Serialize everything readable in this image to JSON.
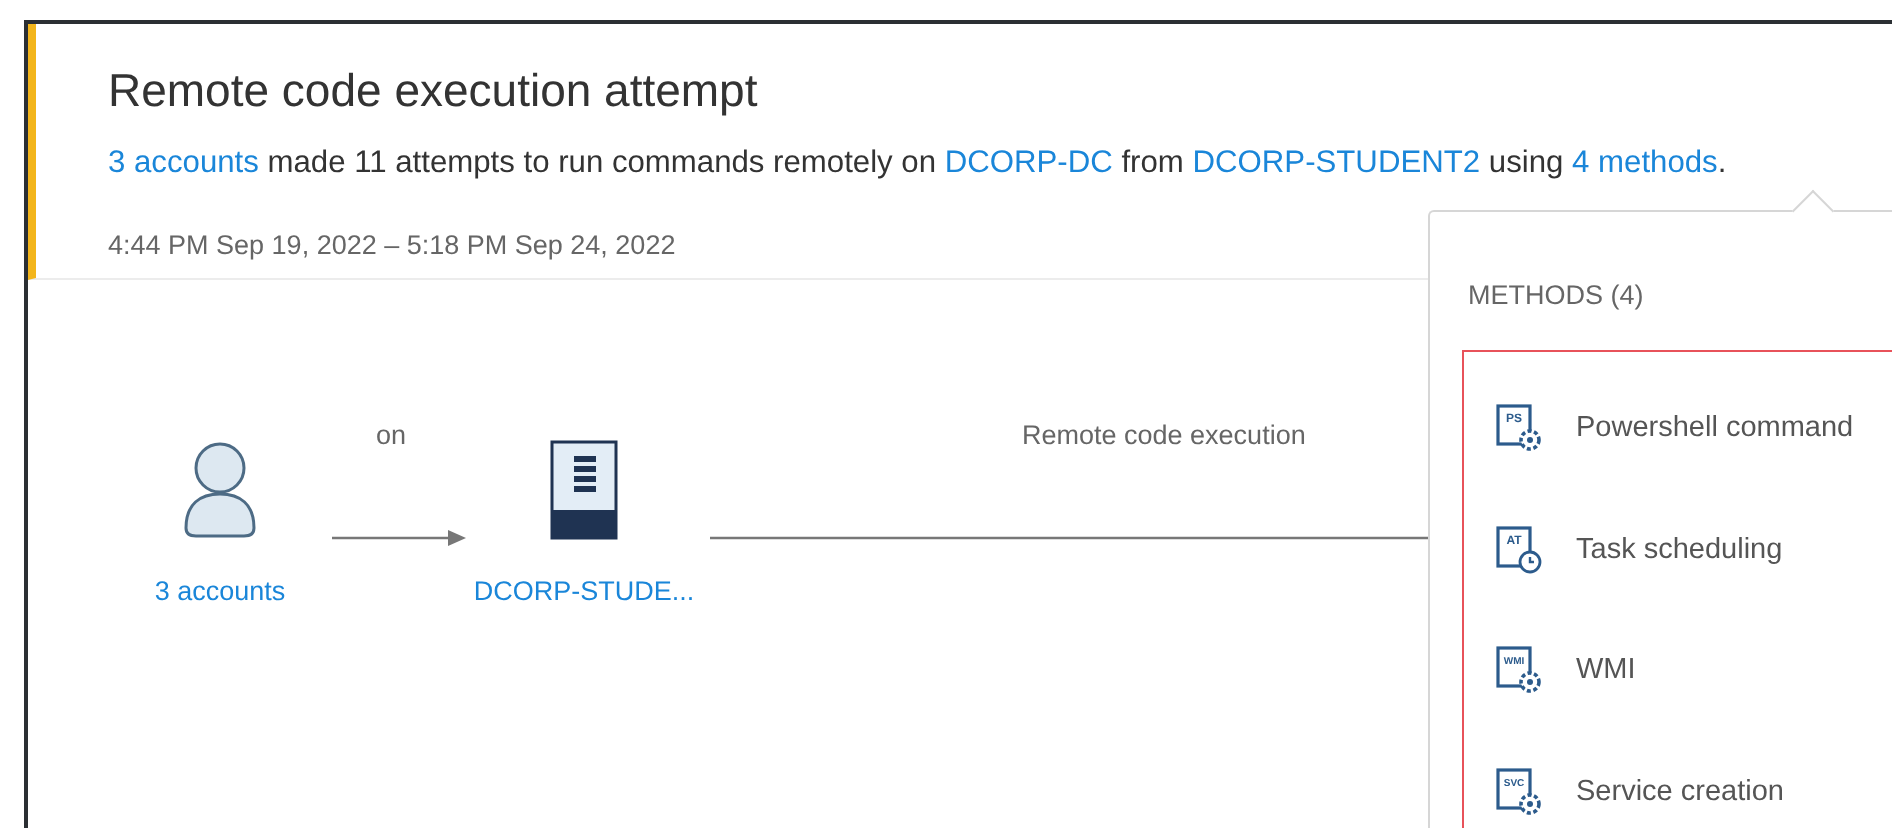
{
  "alert": {
    "title": "Remote code execution attempt",
    "summary": [
      {
        "text": "3 accounts",
        "kind": "link"
      },
      {
        "text": " made 11 attempts to run commands remotely on ",
        "kind": "plain"
      },
      {
        "text": "DCORP-DC",
        "kind": "link"
      },
      {
        "text": " from ",
        "kind": "plain"
      },
      {
        "text": "DCORP-STUDENT2",
        "kind": "link"
      },
      {
        "text": " using ",
        "kind": "plain"
      },
      {
        "text": "4 methods",
        "kind": "link"
      },
      {
        "text": ".",
        "kind": "plain"
      }
    ],
    "time_range": "4:44 PM Sep 19, 2022 – 5:18 PM Sep 24, 2022"
  },
  "diagram": {
    "source": {
      "kind": "user",
      "label": "3 accounts"
    },
    "relation": "on",
    "target": {
      "kind": "server",
      "label": "DCORP-STUDE..."
    },
    "activity": "Remote code execution"
  },
  "methods_popover": {
    "heading": "METHODS (4)",
    "highlighted": true,
    "items": [
      {
        "badge": "PS",
        "kind": "gear",
        "label": "Powershell command"
      },
      {
        "badge": "AT",
        "kind": "clock",
        "label": "Task scheduling"
      },
      {
        "badge": "WMI",
        "kind": "gear",
        "label": "WMI"
      },
      {
        "badge": "SVC",
        "kind": "gear",
        "label": "Service creation"
      }
    ]
  }
}
